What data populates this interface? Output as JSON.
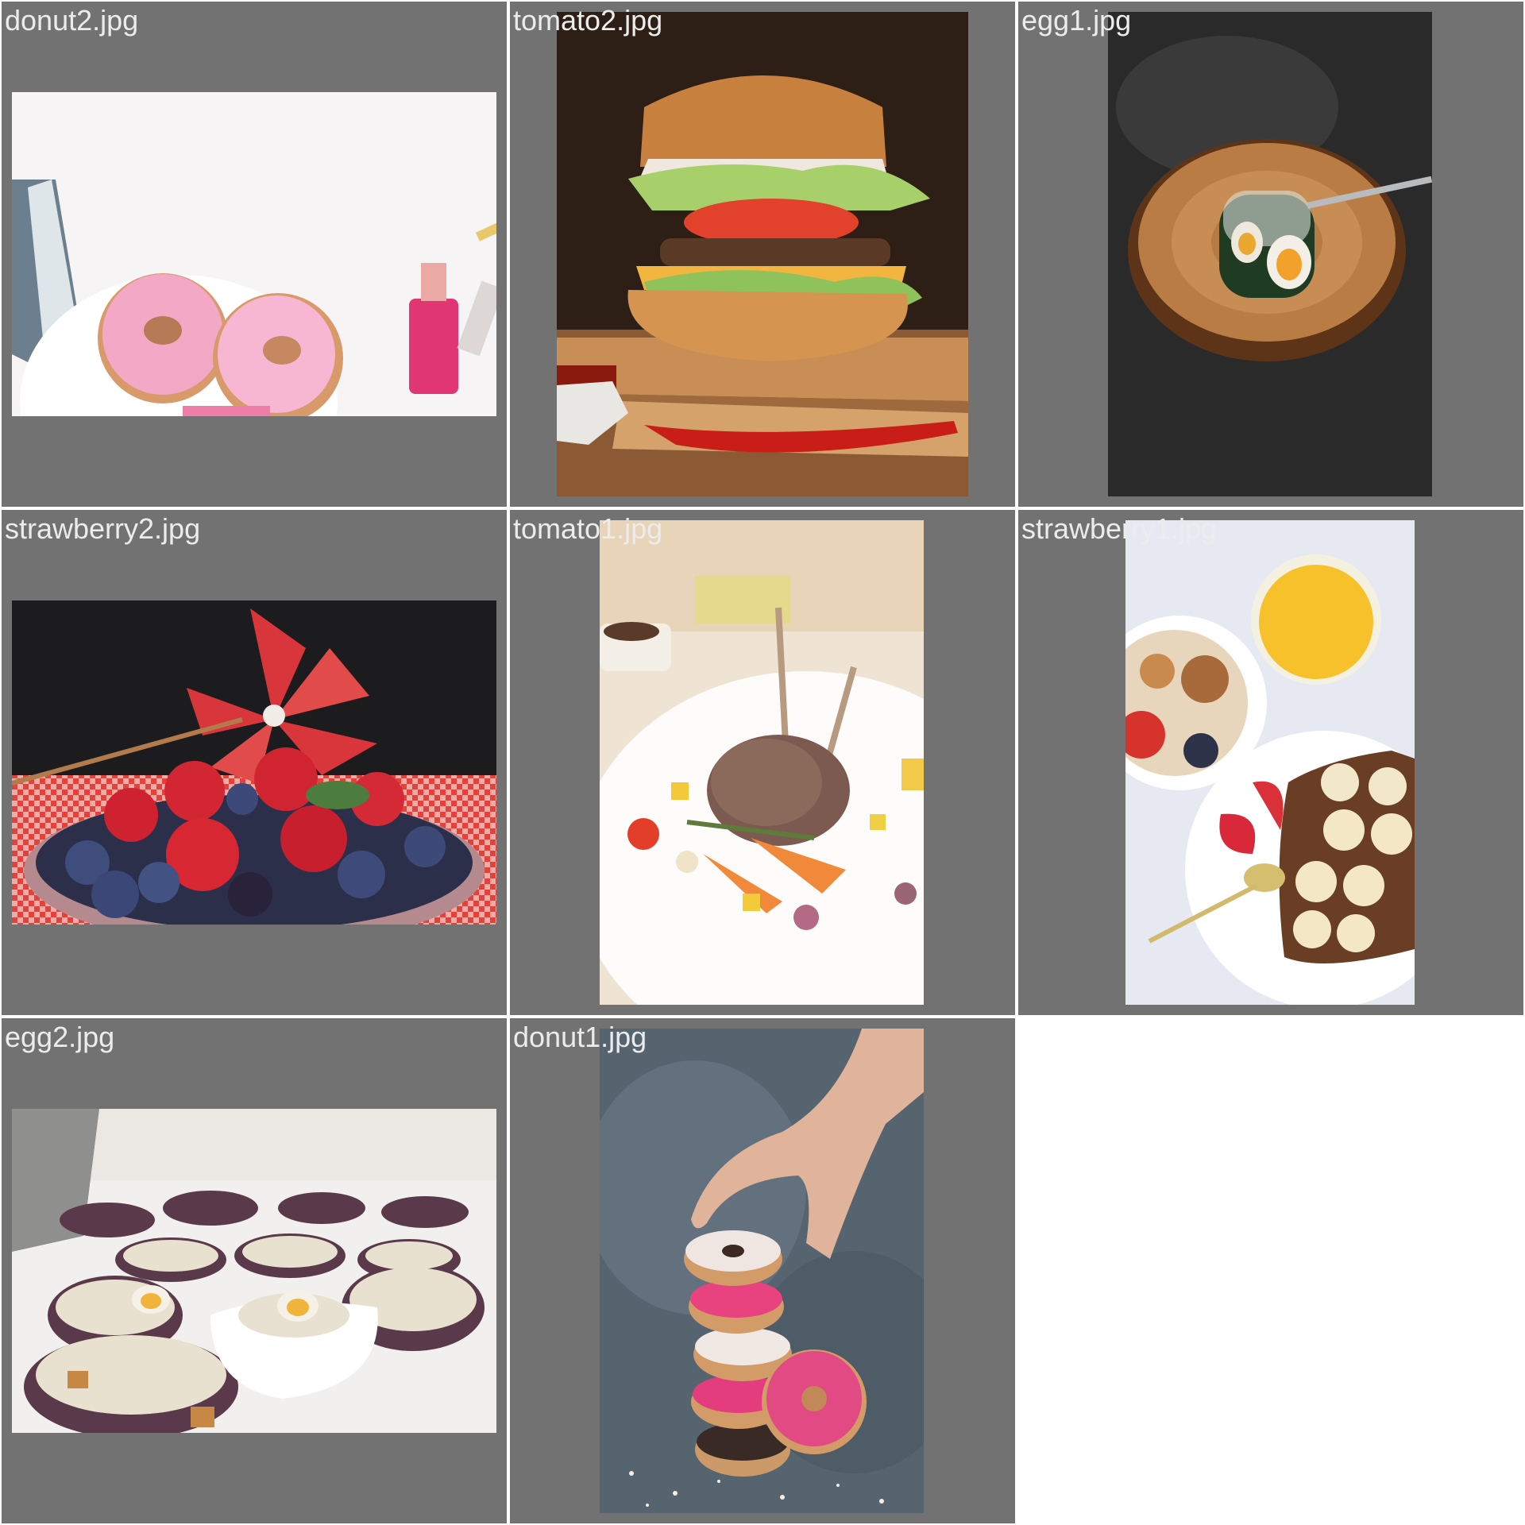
{
  "viewer": {
    "tiles": [
      {
        "filename": "donut2.jpg"
      },
      {
        "filename": "tomato2.jpg"
      },
      {
        "filename": "egg1.jpg"
      },
      {
        "filename": "strawberry2.jpg"
      },
      {
        "filename": "tomato1.jpg"
      },
      {
        "filename": "strawberry1.jpg"
      },
      {
        "filename": "egg2.jpg"
      },
      {
        "filename": "donut1.jpg"
      }
    ]
  },
  "colors": {
    "tile_background": "#727272",
    "page_background": "#ffffff",
    "label_text": "#ececec"
  }
}
